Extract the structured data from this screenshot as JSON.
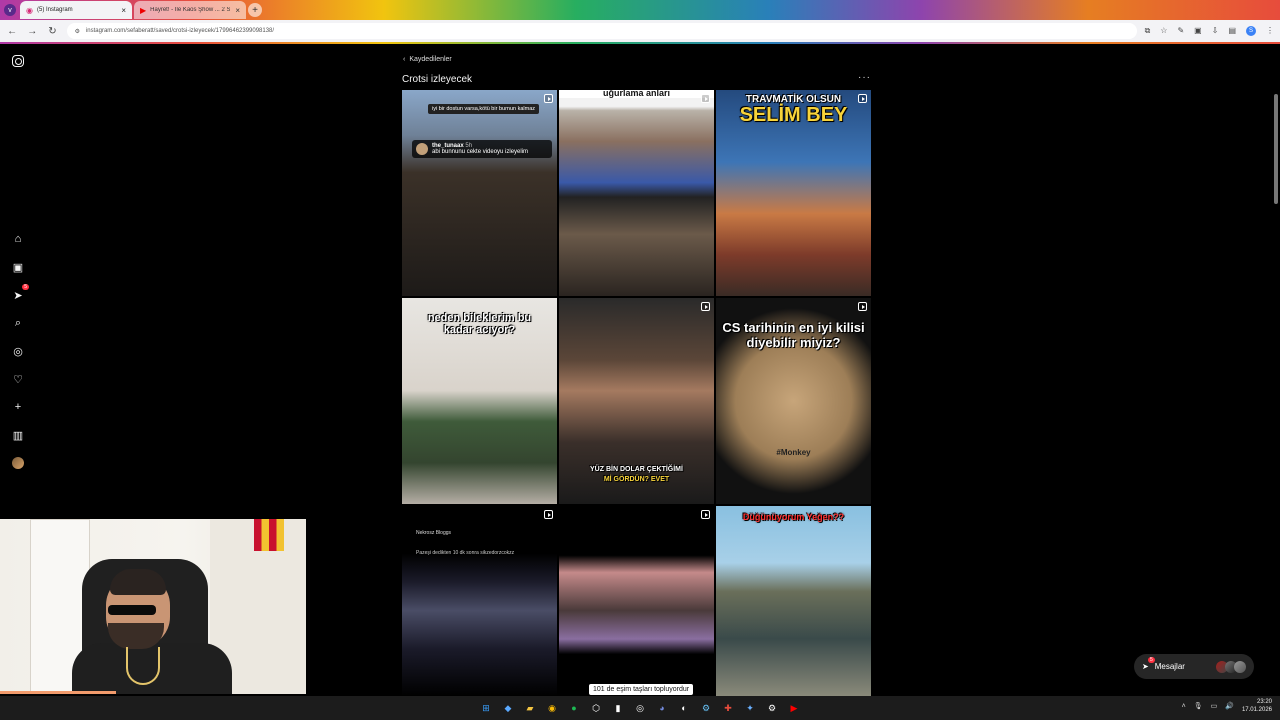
{
  "browser": {
    "tabs": [
      {
        "label": "(5) Instagram",
        "active": true
      },
      {
        "label": "Hayret! - İle Kaos Şhow ... 2 Su...",
        "active": false
      }
    ],
    "menu_badge": "v",
    "url": "instagram.com/sefaberatt/saved/crotsi-izleyecek/17996462399098138/",
    "profile_initial": "S"
  },
  "instagram": {
    "nav": {
      "notifications_count": "5"
    },
    "back_label": "Kaydedilenler",
    "collection_title": "Crotsi izleyecek",
    "more_label": "···",
    "posts": [
      {
        "caption_box": "iyi bir dostun varsa,kötü bir burnun kalmaz",
        "comment_user": "the_tunaax",
        "comment_time": "5h",
        "comment_text": "abi bunnunu cekte videoyu izleyelim",
        "is_reel": true
      },
      {
        "caption": "uğurlama anları",
        "is_reel": true
      },
      {
        "caption_top": "TRAVMATİK OLSUN",
        "caption_main": "SELİM BEY",
        "is_reel": true
      },
      {
        "caption": "neden bileklerim bu kadar acıyor?",
        "is_reel": false
      },
      {
        "caption_line1": "YÜZ BİN DOLAR ÇEKTİĞİMİ",
        "caption_line2": "Mİ GÖRDÜN? EVET",
        "is_reel": true
      },
      {
        "caption": "CS tarihinin en iyi kilisi diyebilir miyiz?",
        "watermark": "#Monkey",
        "is_reel": true
      },
      {
        "tweet_user": "Nekrosz Bloggs",
        "tweet_text": "Pazeşi dedikten 10 dk sonra sikzedorzcokzz",
        "is_reel": true
      },
      {
        "caption": "101 de eşim taşları topluyordur",
        "is_reel": true
      },
      {
        "caption": "Düğünüyorum Yeğen??",
        "is_reel": false
      }
    ],
    "messages_label": "Mesajlar",
    "messages_badge": "5"
  },
  "taskbar": {
    "time": "23:20",
    "date": "17.01.2026"
  }
}
